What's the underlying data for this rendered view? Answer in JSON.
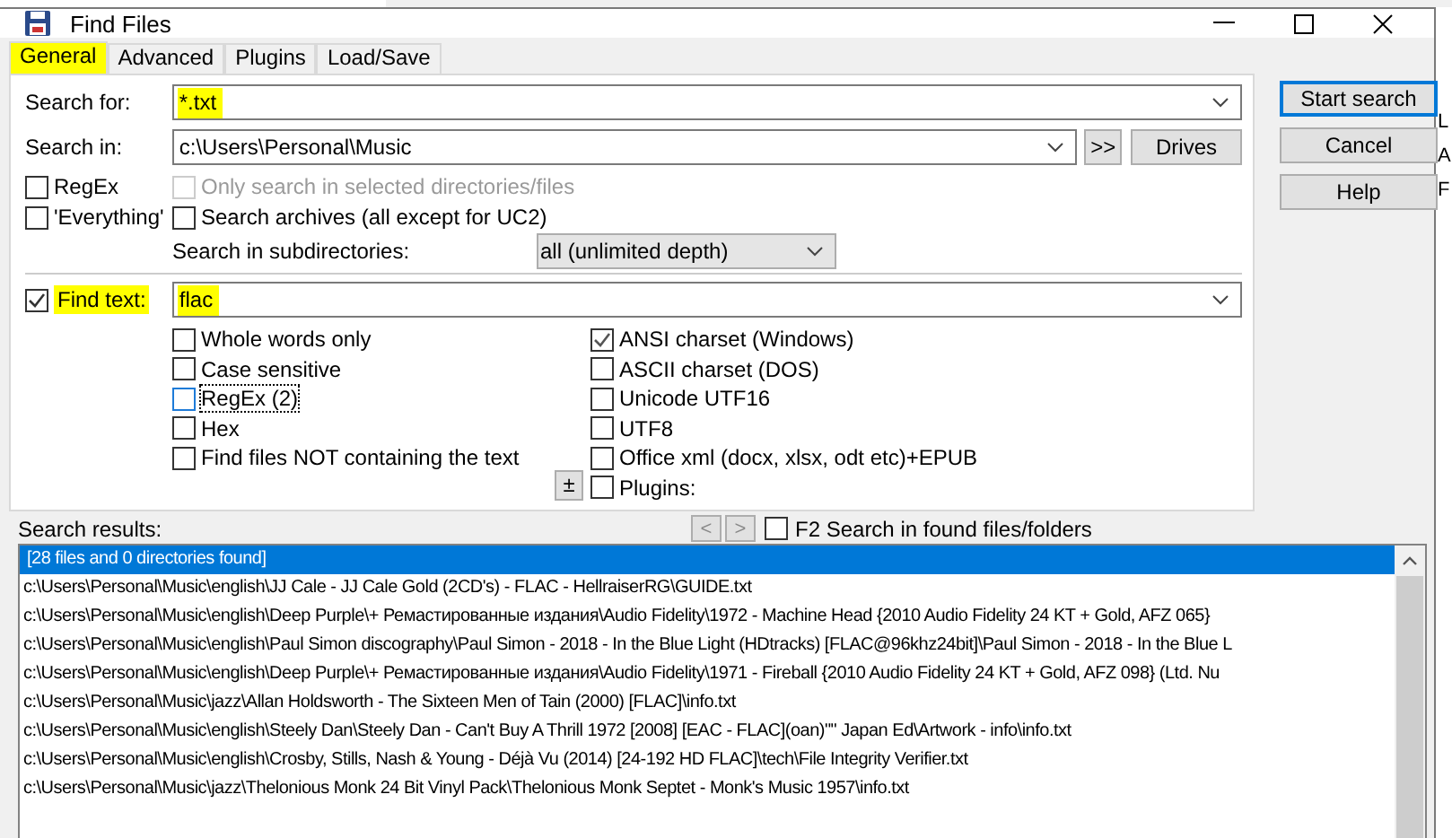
{
  "background_window": {
    "side_text": [
      "L",
      "A",
      "F"
    ]
  },
  "window": {
    "title": "Find Files"
  },
  "tabs": [
    {
      "label": "General",
      "selected": true,
      "highlighted": true
    },
    {
      "label": "Advanced",
      "selected": false,
      "highlighted": false
    },
    {
      "label": "Plugins",
      "selected": false,
      "highlighted": false
    },
    {
      "label": "Load/Save",
      "selected": false,
      "highlighted": false
    }
  ],
  "search_for": {
    "label": "Search for:",
    "value": "*.txt",
    "highlighted": true
  },
  "search_in": {
    "label": "Search in:",
    "value": "c:\\Users\\Personal\\Music",
    "browse_button": ">>",
    "drives_button": "Drives"
  },
  "left_options": [
    {
      "label": "RegEx",
      "checked": false
    },
    {
      "label": "'Everything'",
      "checked": false
    }
  ],
  "scope_options": [
    {
      "label": "Only search in selected directories/files",
      "checked": false,
      "disabled": true
    },
    {
      "label": "Search archives (all except for UC2)",
      "checked": false,
      "disabled": false
    }
  ],
  "subdirectories": {
    "label": "Search in subdirectories:",
    "value": "all (unlimited depth)"
  },
  "find_text": {
    "label": "Find text:",
    "checked": true,
    "value": "flac",
    "highlighted": true
  },
  "text_options": [
    {
      "label": "Whole words only",
      "checked": false,
      "focused": false
    },
    {
      "label": "Case sensitive",
      "checked": false,
      "focused": false
    },
    {
      "label": "RegEx (2)",
      "checked": false,
      "focused": true
    },
    {
      "label": "Hex",
      "checked": false,
      "focused": false
    },
    {
      "label": "Find files NOT containing the text",
      "checked": false,
      "focused": false
    }
  ],
  "charset_options": [
    {
      "label": "ANSI charset (Windows)",
      "checked": true
    },
    {
      "label": "ASCII charset (DOS)",
      "checked": false
    },
    {
      "label": "Unicode UTF16",
      "checked": false
    },
    {
      "label": "UTF8",
      "checked": false
    },
    {
      "label": "Office xml (docx, xlsx, odt etc)+EPUB",
      "checked": false
    },
    {
      "label": "Plugins:",
      "checked": false
    }
  ],
  "plus_minus_button": "±",
  "buttons": [
    {
      "label": "Start search",
      "default": true
    },
    {
      "label": "Cancel",
      "default": false
    },
    {
      "label": "Help",
      "default": false
    }
  ],
  "results": {
    "label": "Search results:",
    "prev_button": "<",
    "next_button": ">",
    "search_in_found": {
      "label": "F2 Search in found files/folders",
      "checked": false
    },
    "rows": [
      {
        "text": "[28 files and 0 directories found]",
        "selected": true
      },
      {
        "text": "c:\\Users\\Personal\\Music\\english\\JJ Cale - JJ Cale Gold (2CD's) - FLAC - HellraiserRG\\GUIDE.txt",
        "selected": false
      },
      {
        "text": "c:\\Users\\Personal\\Music\\english\\Deep Purple\\+ Ремастированные издания\\Audio Fidelity\\1972 - Machine Head {2010 Audio Fidelity 24 KT + Gold, AFZ 065}",
        "selected": false
      },
      {
        "text": "c:\\Users\\Personal\\Music\\english\\Paul Simon discography\\Paul Simon - 2018 - In the Blue Light (HDtracks) [FLAC@96khz24bit]\\Paul Simon - 2018 - In the Blue L",
        "selected": false
      },
      {
        "text": "c:\\Users\\Personal\\Music\\english\\Deep Purple\\+ Ремастированные издания\\Audio Fidelity\\1971 - Fireball {2010 Audio Fidelity 24 KT + Gold, AFZ 098} (Ltd. Nu",
        "selected": false
      },
      {
        "text": "c:\\Users\\Personal\\Music\\jazz\\Allan Holdsworth - The Sixteen Men of Tain (2000) [FLAC]\\info.txt",
        "selected": false
      },
      {
        "text": "c:\\Users\\Personal\\Music\\english\\Steely Dan\\Steely Dan - Can't Buy A Thrill 1972 [2008] [EAC - FLAC](oan)\"\" Japan Ed\\Artwork - info\\info.txt",
        "selected": false
      },
      {
        "text": "c:\\Users\\Personal\\Music\\english\\Crosby, Stills, Nash & Young - Déjà Vu (2014) [24-192 HD FLAC]\\tech\\File Integrity Verifier.txt",
        "selected": false
      },
      {
        "text": "c:\\Users\\Personal\\Music\\jazz\\Thelonious Monk 24 Bit Vinyl Pack\\Thelonious Monk Septet - Monk's Music 1957\\info.txt",
        "selected": false
      }
    ]
  }
}
